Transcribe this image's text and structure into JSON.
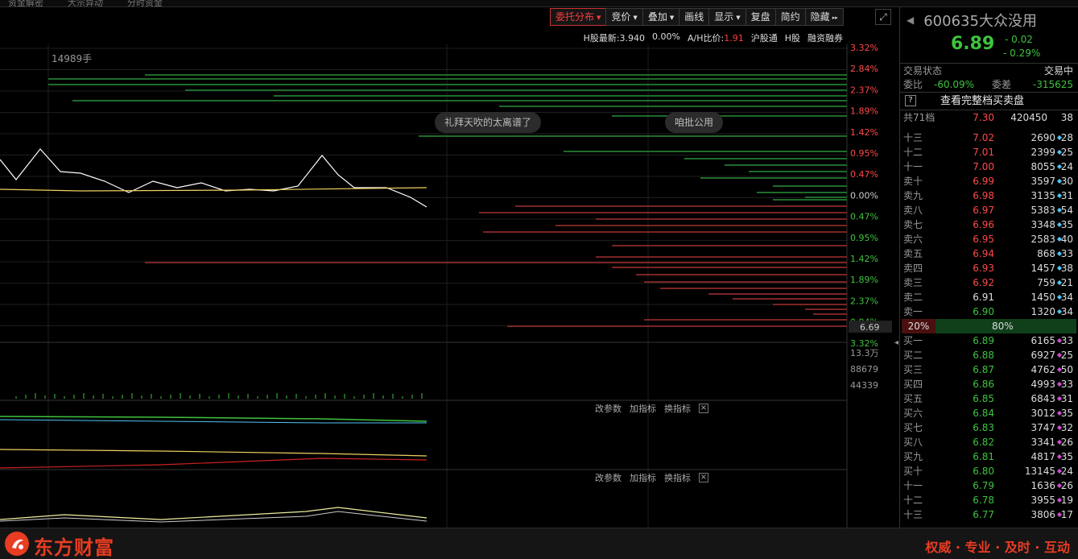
{
  "topstrip": {
    "items": [
      "资金解密",
      "大宗异动",
      "分时资金"
    ]
  },
  "toolbar": [
    {
      "label": "委托分布",
      "dropdown": true,
      "active": true
    },
    {
      "label": "竞价",
      "dropdown": true
    },
    {
      "label": "叠加",
      "dropdown": true
    },
    {
      "label": "画线",
      "dropdown": false
    },
    {
      "label": "显示",
      "dropdown": true
    },
    {
      "label": "复盘",
      "dropdown": false
    },
    {
      "label": "简约",
      "dropdown": false
    },
    {
      "label": "隐藏",
      "dropdown": false,
      "suffix": "▸▸"
    }
  ],
  "expand_icon": "expand-icon",
  "infobar": {
    "h_latest": "H股最新:3.940",
    "h_pct": "0.00%",
    "ah_label": "A/H比价:",
    "ah_value": "1.91",
    "links": [
      "沪股通",
      "H股",
      "融资融券"
    ]
  },
  "chart": {
    "volume_label": "14989手",
    "right_axis": [
      "3.32%",
      "2.84%",
      "2.37%",
      "1.89%",
      "1.42%",
      "0.95%",
      "0.47%",
      "0.00%",
      "0.47%",
      "0.95%",
      "1.42%",
      "1.89%",
      "2.37%",
      "0.94%",
      "3.32%"
    ],
    "cursor_price": "6.69",
    "vol_axis": [
      "13.3万",
      "88679",
      "44339"
    ],
    "bubbles": [
      "礼拜天吹的太离谱了",
      "咱批公用"
    ],
    "indicator_controls": [
      "改参数",
      "加指标",
      "换指标"
    ]
  },
  "stock": {
    "code_name": "600635大众没用",
    "price": "6.89",
    "change": "- 0.02",
    "change_pct": "- 0.29%"
  },
  "status": {
    "label": "交易状态",
    "value": "交易中"
  },
  "weibi": {
    "label": "委比",
    "value": "-60.09%",
    "diff_label": "委差",
    "diff_value": "-315625"
  },
  "full_book": {
    "help": "?",
    "label": "查看完整档买卖盘"
  },
  "total": {
    "label": "共71档",
    "price": "7.30",
    "vol": "420450",
    "cnt": "38"
  },
  "asks": [
    {
      "label": "十三",
      "price": "7.02",
      "vol": "2690",
      "cnt": "28",
      "color": "red"
    },
    {
      "label": "十二",
      "price": "7.01",
      "vol": "2399",
      "cnt": "25",
      "color": "red"
    },
    {
      "label": "十一",
      "price": "7.00",
      "vol": "8055",
      "cnt": "24",
      "color": "red"
    },
    {
      "label": "卖十",
      "price": "6.99",
      "vol": "3597",
      "cnt": "30",
      "color": "red"
    },
    {
      "label": "卖九",
      "price": "6.98",
      "vol": "3135",
      "cnt": "31",
      "color": "red"
    },
    {
      "label": "卖八",
      "price": "6.97",
      "vol": "5383",
      "cnt": "54",
      "color": "red"
    },
    {
      "label": "卖七",
      "price": "6.96",
      "vol": "3348",
      "cnt": "35",
      "color": "red"
    },
    {
      "label": "卖六",
      "price": "6.95",
      "vol": "2583",
      "cnt": "40",
      "color": "red"
    },
    {
      "label": "卖五",
      "price": "6.94",
      "vol": "868",
      "cnt": "33",
      "color": "red"
    },
    {
      "label": "卖四",
      "price": "6.93",
      "vol": "1457",
      "cnt": "38",
      "color": "red"
    },
    {
      "label": "卖三",
      "price": "6.92",
      "vol": "759",
      "cnt": "21",
      "color": "red"
    },
    {
      "label": "卖二",
      "price": "6.91",
      "vol": "1450",
      "cnt": "34",
      "color": "white"
    },
    {
      "label": "卖一",
      "price": "6.90",
      "vol": "1320",
      "cnt": "34",
      "color": "green"
    }
  ],
  "ratio": {
    "sell": "20%",
    "buy": "80%"
  },
  "bids": [
    {
      "label": "买一",
      "price": "6.89",
      "vol": "6165",
      "cnt": "33"
    },
    {
      "label": "买二",
      "price": "6.88",
      "vol": "6927",
      "cnt": "25"
    },
    {
      "label": "买三",
      "price": "6.87",
      "vol": "4762",
      "cnt": "50"
    },
    {
      "label": "买四",
      "price": "6.86",
      "vol": "4993",
      "cnt": "33"
    },
    {
      "label": "买五",
      "price": "6.85",
      "vol": "6843",
      "cnt": "31"
    },
    {
      "label": "买六",
      "price": "6.84",
      "vol": "3012",
      "cnt": "35"
    },
    {
      "label": "买七",
      "price": "6.83",
      "vol": "3747",
      "cnt": "32"
    },
    {
      "label": "买八",
      "price": "6.82",
      "vol": "3341",
      "cnt": "26"
    },
    {
      "label": "买九",
      "price": "6.81",
      "vol": "4817",
      "cnt": "35"
    },
    {
      "label": "买十",
      "price": "6.80",
      "vol": "13145",
      "cnt": "24"
    },
    {
      "label": "十一",
      "price": "6.79",
      "vol": "1636",
      "cnt": "26"
    },
    {
      "label": "十二",
      "price": "6.78",
      "vol": "3955",
      "cnt": "19"
    },
    {
      "label": "十三",
      "price": "6.77",
      "vol": "3806",
      "cnt": "17"
    }
  ],
  "footer": {
    "brand": "东方财富",
    "slogan": "权威 · 专业 · 及时 · 互动"
  }
}
